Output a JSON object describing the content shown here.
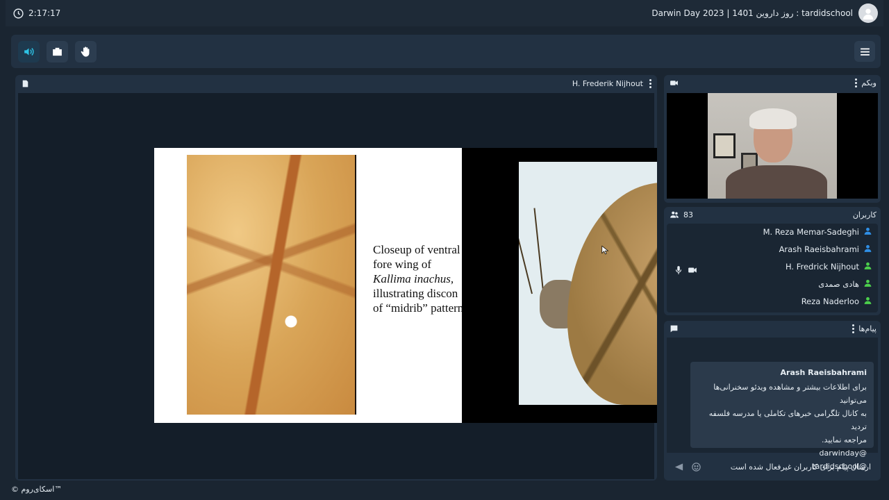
{
  "topbar": {
    "time": "2:17:17",
    "room_name": "tardidschool : روز داروین 1401 | Darwin Day 2023"
  },
  "toolbar": {
    "audio_icon": "speaker-icon",
    "share_icon": "window-icon",
    "hand_icon": "raise-hand-icon",
    "menu_icon": "hamburger-icon"
  },
  "stage": {
    "presenter": "H. Frederik Nijhout",
    "slide": {
      "line1": "Closeup of ventral",
      "line2": "fore wing of",
      "line3_italic": "Kallima inachus,",
      "line4": "illustrating discon",
      "line5": "of “midrib” pattern"
    }
  },
  "webcam": {
    "title": "وبکم"
  },
  "users": {
    "title": "کاربران",
    "count": "83",
    "list": [
      {
        "name": "M. Reza Memar-Sadeghi",
        "color": "#2f8fe6"
      },
      {
        "name": "Arash Raeisbahrami",
        "color": "#2f8fe6"
      },
      {
        "name": "H. Fredrick Nijhout",
        "color": "#4ccf4c"
      },
      {
        "name": "هادی صمدی",
        "color": "#4ccf4c"
      },
      {
        "name": "Reza Naderloo",
        "color": "#4ccf4c"
      }
    ]
  },
  "chat": {
    "title": "پیام‌ها",
    "message": {
      "sender": "Arash Raeisbahrami",
      "line1": "برای اطلاعات بیشتر و مشاهده ویدئو سخنرانی‌ها می‌توانید",
      "line2": "به کانال تلگرامی خبرهای تکاملی یا مدرسه فلسفه تردید",
      "line3": "مراجعه نمایید.",
      "line4": "@darwinday",
      "line5": "@tardidschool"
    },
    "input_placeholder": "ارسال پیام برای کاربران غیرفعال شده است"
  },
  "footer": {
    "brand": "© اسکای‌روم™"
  },
  "colors": {
    "background": "#1a2531",
    "panel": "#223142",
    "accent": "#2ec4e6",
    "online": "#4ccf4c",
    "viewer": "#2f8fe6"
  }
}
